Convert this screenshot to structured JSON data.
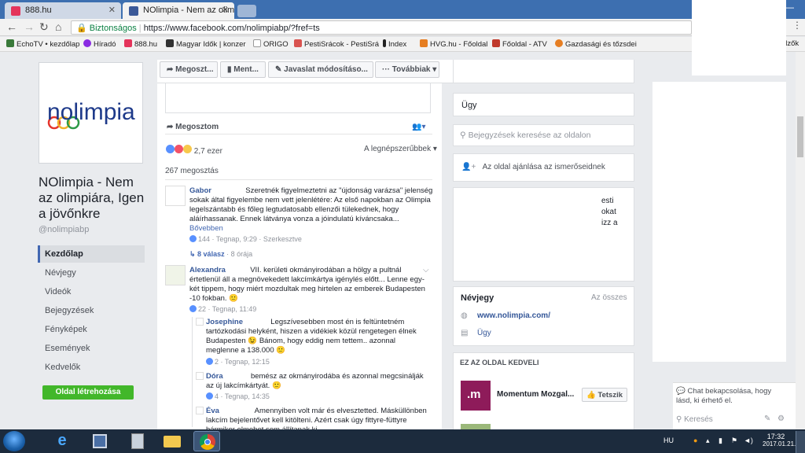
{
  "browser": {
    "tabs": [
      {
        "title": "888.hu",
        "favicon_color": "#e4345b"
      },
      {
        "title": "NOlimpia - Nem az olim",
        "favicon_color": "#3b5998"
      }
    ],
    "url_security": "Biztonságos",
    "url": "https://www.facebook.com/nolimpiabp/?fref=ts",
    "bookmarks": [
      {
        "label": "EchoTV • kezdőlap",
        "color": "#3a7a3a"
      },
      {
        "label": "Híradó",
        "color": "#8a2be2"
      },
      {
        "label": "888.hu",
        "color": "#e4345b"
      },
      {
        "label": "Magyar Idők | konzer",
        "color": "#333333"
      },
      {
        "label": "ORIGO",
        "color": "#ffffff"
      },
      {
        "label": "PestiSrácok - PestiSrá",
        "color": "#d9534f"
      },
      {
        "label": "Index",
        "color": "#222222"
      },
      {
        "label": "HVG.hu - Főoldal",
        "color": "#e67e22"
      },
      {
        "label": "Főoldal - ATV",
        "color": "#c0392b"
      },
      {
        "label": "Gazdasági és tőzsdei",
        "color": "#e67e22"
      }
    ],
    "bookmarks_overflow": "elzők"
  },
  "sidebar": {
    "page_name": "NOlimpia - Nem az olimpiára, Igen a jövőnkre",
    "handle": "@nolimpiabp",
    "logo_text": "nolimpia",
    "menu": [
      "Kezdőlap",
      "Névjegy",
      "Videók",
      "Bejegyzések",
      "Fényképek",
      "Események",
      "Kedvelők"
    ],
    "create_page": "Oldal létrehozása"
  },
  "actions": {
    "share": "Megoszt...",
    "save": "Ment...",
    "suggest": "Javaslat módosításo...",
    "more": "Továbbiak"
  },
  "post": {
    "share_label": "Megosztom",
    "reactions_count": "2,7 ezer",
    "sort_label": "A legnépszerűbbek",
    "shares": "267 megosztás",
    "comments": [
      {
        "name": "Gabor",
        "text": "Szeretnék figyelmeztetni az \"újdonság varázsa\" jelenség sokak által figyelembe nem vett jelenlétére: Az első napokban az Olimpia legelszántabb és főleg legtudatosabb ellenzői tülekednek, hogy aláírhassanak. Ennek látványa vonza a jóindulatú kíváncsaka...",
        "more": "Bővebben",
        "likes": "144",
        "time": "Tegnap, 9:29",
        "edited": "Szerkesztve",
        "replies": "8 válasz",
        "replies_time": "8 órája"
      },
      {
        "name": "Alexandra",
        "text": "VII. kerületi okmányirodában a hölgy a pultnál értetlenül áll a megnövekedett lakcímkártya igénylés előtt... Lenne egy-két tippem, hogy miért mozdultak meg hirtelen az emberek Budapesten -10 fokban. 🙂",
        "likes": "22",
        "time": "Tegnap, 11:49"
      }
    ],
    "replies": [
      {
        "name": "Josephine",
        "text": "Legszívesebben most én is feltüntetném tartózkodási helyként, hiszen a vidékiek közül rengetegen élnek Budapesten 😉 Bánom, hogy eddig nem tettem.. azonnal meglenne a 138.000 🙂",
        "likes": "2",
        "time": "Tegnap, 12:15"
      },
      {
        "name": "Dóra",
        "text": "bemész az okmányirodába és azonnal megcsinálják az új lakcímkártyát. 🙂",
        "likes": "4",
        "time": "Tegnap, 14:35"
      },
      {
        "name": "Éva",
        "text": "Amennyiben volt már és elvesztetted. Másküllönben lakcím bejelentővet kell kitölteni. Azért csak úgy fittyre-füttyre bármikor elmehet sem állítanak ki..."
      }
    ]
  },
  "right": {
    "category": "Ügy",
    "search_placeholder": "Bejegyzések keresése az oldalon",
    "invite": "Az oldal ajánlása az ismerőseidnek",
    "partial_text": [
      "esti",
      "okat",
      "izz a"
    ],
    "about_title": "Névjegy",
    "about_all": "Az összes",
    "website": "www.nolimpia.com/",
    "category2": "Ügy",
    "liked_title": "EZ AZ OLDAL KEDVELI",
    "liked_page": "Momentum Mozgal...",
    "like_btn": "Tetszik"
  },
  "chat": {
    "notice": "Chat bekapcsolása, hogy lásd, ki érhető el.",
    "search": "Keresés"
  },
  "taskbar": {
    "lang": "HU",
    "time": "17:32",
    "date": "2017.01.21."
  }
}
